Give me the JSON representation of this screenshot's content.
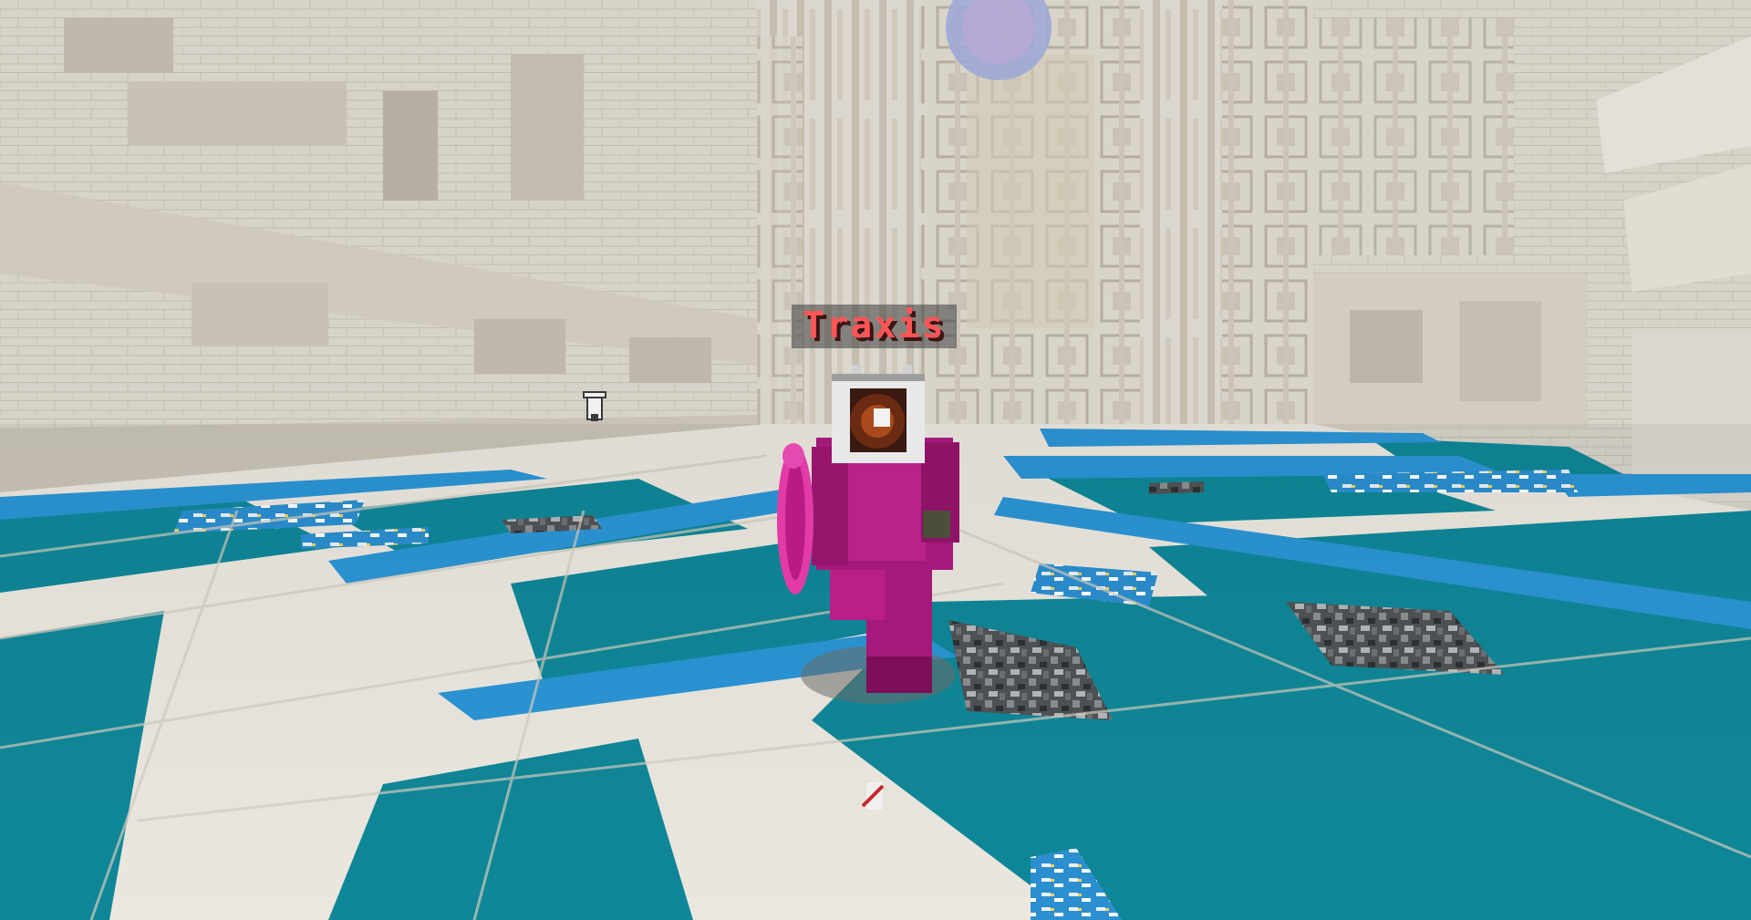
{
  "player": {
    "name": "Traxis",
    "name_color": "#ff5555"
  },
  "colors": {
    "stone": "#d8d3c9",
    "stone_dark": "#b9b3a7",
    "floor_tile": "#ebe7df",
    "teal": "#0f8798",
    "blue_stripe": "#2b95d5",
    "armor": "#a5197a"
  },
  "icons": [
    "banner-item-icon",
    "dropped-item-icon",
    "pink-shield-icon",
    "player-head-icon"
  ]
}
